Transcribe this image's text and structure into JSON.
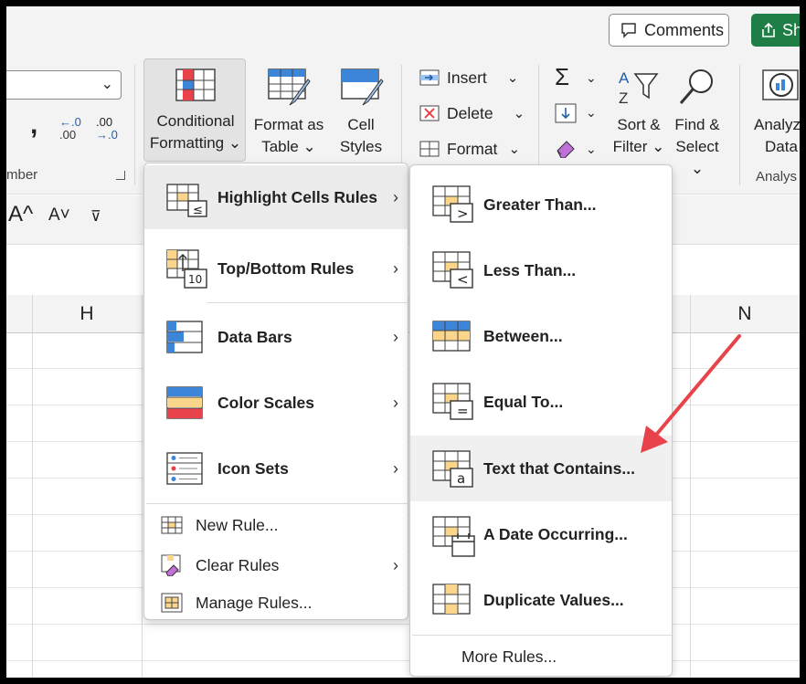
{
  "top_bar": {
    "comments_label": "Comments",
    "share_label": "Sh"
  },
  "ribbon": {
    "number_group_label": "mber",
    "comma_label": ",",
    "increase_decimal_top": "←.0",
    "increase_decimal_bottom": ".00",
    "decrease_decimal_top": ".00",
    "decrease_decimal_bottom": "→.0",
    "conditional_formatting": {
      "line1": "Conditional",
      "line2": "Formatting ⌄"
    },
    "format_as_table": {
      "line1": "Format as",
      "line2": "Table ⌄"
    },
    "cell_styles": {
      "line1": "Cell",
      "line2": "Styles ⌄"
    },
    "insert_label": "Insert",
    "delete_label": "Delete",
    "format_label": "Format",
    "sort_filter": {
      "line1": "Sort &",
      "line2": "Filter ⌄"
    },
    "find_select": {
      "line1": "Find &",
      "line2": "Select ⌄"
    },
    "analyze_data": {
      "line1": "Analyz",
      "line2": "Data"
    },
    "analysis_group_label": "Analys",
    "font_increase": "A^",
    "font_decrease": "A˅"
  },
  "grid": {
    "columns": [
      "H",
      "N"
    ]
  },
  "cf_menu": {
    "items": [
      {
        "label": "Highlight Cells Rules",
        "has_submenu": true,
        "bold": true
      },
      {
        "label": "Top/Bottom Rules",
        "has_submenu": true,
        "bold": true
      },
      {
        "label": "Data Bars",
        "has_submenu": true,
        "bold": true
      },
      {
        "label": "Color Scales",
        "has_submenu": true,
        "bold": true
      },
      {
        "label": "Icon Sets",
        "has_submenu": true,
        "bold": true
      },
      {
        "label": "New Rule...",
        "has_submenu": false,
        "bold": false
      },
      {
        "label": "Clear Rules",
        "has_submenu": true,
        "bold": false
      },
      {
        "label": "Manage Rules...",
        "has_submenu": false,
        "bold": false
      }
    ]
  },
  "highlight_submenu": {
    "items": [
      {
        "label": "Greater Than..."
      },
      {
        "label": "Less Than..."
      },
      {
        "label": "Between..."
      },
      {
        "label": "Equal To..."
      },
      {
        "label": "Text that Contains..."
      },
      {
        "label": "A Date Occurring..."
      },
      {
        "label": "Duplicate Values..."
      }
    ],
    "more_rules": "More Rules..."
  },
  "icon_glyphs": {
    "greater": ">",
    "less": "<",
    "equal": "=",
    "text": "a",
    "topten": "10",
    "le": "≤"
  },
  "colors": {
    "accent_red": "#e8434a",
    "highlight_yellow": "#fbd68a",
    "bar_blue": "#3d85d8",
    "share_green": "#1e7e45"
  }
}
